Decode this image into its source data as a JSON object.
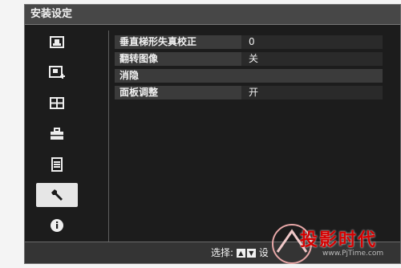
{
  "window": {
    "title": "安装设定"
  },
  "sidebar": {
    "items": [
      {
        "icon": "picture-icon",
        "active": false
      },
      {
        "icon": "picture-adjust-icon",
        "active": false
      },
      {
        "icon": "screen-grid-icon",
        "active": false
      },
      {
        "icon": "toolbox-icon",
        "active": false
      },
      {
        "icon": "list-settings-icon",
        "active": false
      },
      {
        "icon": "wrench-icon",
        "active": true
      },
      {
        "icon": "info-icon",
        "active": false
      }
    ]
  },
  "menu": {
    "rows": [
      {
        "label": "垂直梯形失真校正",
        "value": "0"
      },
      {
        "label": "翻转图像",
        "value": "关"
      },
      {
        "label": "消隐",
        "value": ""
      },
      {
        "label": "面板调整",
        "value": "开"
      }
    ]
  },
  "footer": {
    "hint_prefix": "选择:",
    "hint_suffix": "设"
  },
  "watermark": {
    "text": "投影时代",
    "url": "www.PjTime.com"
  },
  "colors": {
    "active_item_bg": "#e6e6e6",
    "menu_bg": "#1c1c1c",
    "watermark_red": "#d50000"
  }
}
